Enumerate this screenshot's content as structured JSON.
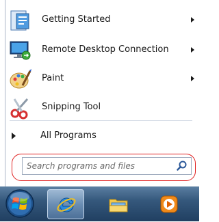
{
  "start_menu": {
    "items": [
      {
        "label": "Getting Started",
        "icon": "getting-started-icon",
        "has_submenu": true
      },
      {
        "label": "Remote Desktop Connection",
        "icon": "remote-desktop-icon",
        "has_submenu": true
      },
      {
        "label": "Paint",
        "icon": "paint-icon",
        "has_submenu": true
      },
      {
        "label": "Snipping Tool",
        "icon": "snipping-tool-icon",
        "has_submenu": false
      }
    ],
    "all_programs_label": "All Programs",
    "search": {
      "placeholder": "Search programs and files",
      "value": ""
    }
  },
  "taskbar": {
    "buttons": [
      {
        "icon": "start-orb-icon"
      },
      {
        "icon": "internet-explorer-icon",
        "active": true
      },
      {
        "icon": "windows-explorer-icon"
      },
      {
        "icon": "media-player-icon"
      }
    ]
  },
  "colors": {
    "highlight": "#e02020",
    "taskbar": "#2a4a6e"
  }
}
